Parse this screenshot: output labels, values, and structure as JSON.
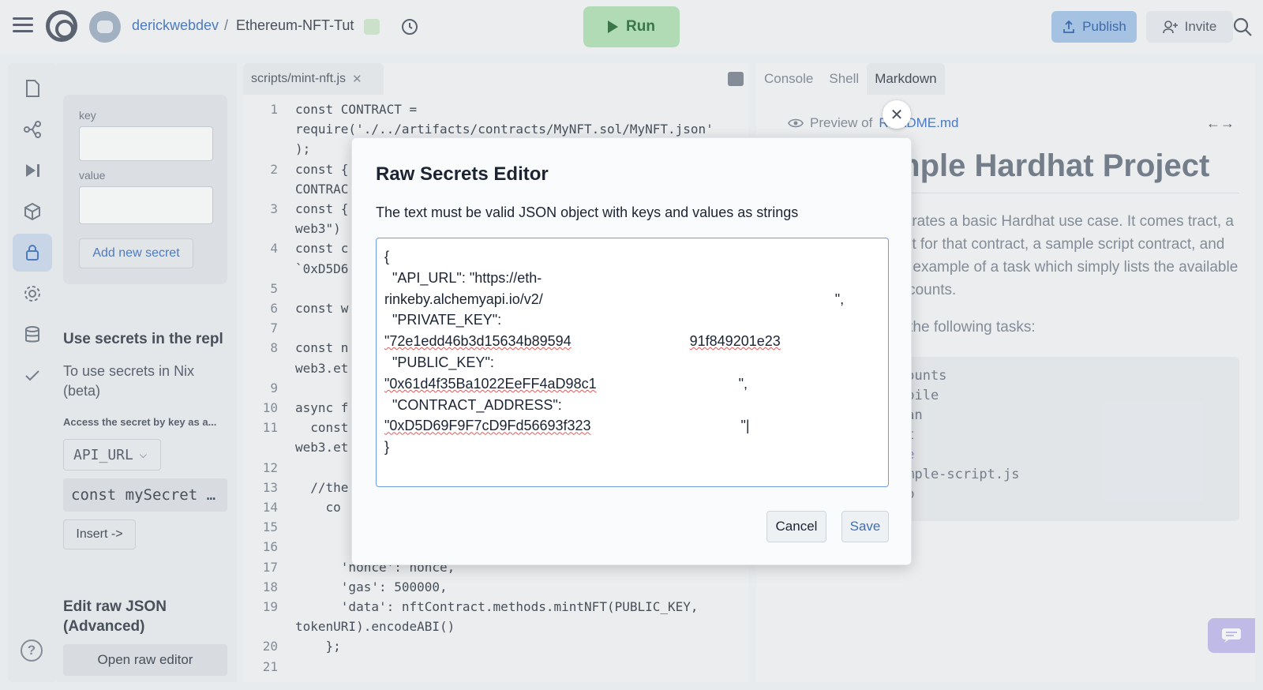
{
  "topbar": {
    "username": "derickwebdev",
    "separator": "/",
    "repl_name": "Ethereum-NFT-Tut",
    "run_label": "Run",
    "publish_label": "Publish",
    "invite_label": "Invite"
  },
  "sidebar": {
    "icons": [
      "files-icon",
      "version-control-icon",
      "debugger-icon",
      "packages-icon",
      "secrets-lock-icon",
      "settings-gear-icon",
      "database-icon",
      "checkmark-icon"
    ],
    "active": "secrets-lock-icon"
  },
  "secrets": {
    "key_label": "key",
    "value_label": "value",
    "add_button": "Add new secret",
    "use_heading": "Use secrets in the repl",
    "use_text": "To use secrets in Nix (beta)",
    "access_text": "Access the secret by key as a...",
    "selected_key": "API_URL",
    "code_snippet": "const mySecret …",
    "insert_button": "Insert ->",
    "edit_heading": "Edit raw JSON (Advanced)",
    "open_raw_button": "Open raw editor"
  },
  "editor": {
    "file_tab": "scripts/mint-nft.js",
    "lines": [
      {
        "n": "1",
        "t": "const CONTRACT ="
      },
      {
        "n": "",
        "t": "require('./../artifacts/contracts/MyNFT.sol/MyNFT.json'"
      },
      {
        "n": "",
        "t": ");"
      },
      {
        "n": "2",
        "t": "const {"
      },
      {
        "n": "",
        "t": "CONTRAC"
      },
      {
        "n": "3",
        "t": "const {"
      },
      {
        "n": "",
        "t": "web3\")"
      },
      {
        "n": "4",
        "t": "const c"
      },
      {
        "n": "",
        "t": "`0xD5D6"
      },
      {
        "n": "5",
        "t": ""
      },
      {
        "n": "6",
        "t": "const w"
      },
      {
        "n": "7",
        "t": ""
      },
      {
        "n": "8",
        "t": "const n"
      },
      {
        "n": "",
        "t": "web3.et"
      },
      {
        "n": "9",
        "t": ""
      },
      {
        "n": "10",
        "t": "async f"
      },
      {
        "n": "11",
        "t": "  const"
      },
      {
        "n": "",
        "t": "web3.et"
      },
      {
        "n": "12",
        "t": ""
      },
      {
        "n": "13",
        "t": "  //the"
      },
      {
        "n": "14",
        "t": "    co"
      },
      {
        "n": "15",
        "t": ""
      },
      {
        "n": "16",
        "t": ""
      },
      {
        "n": "17",
        "t": "      'nonce': nonce,"
      },
      {
        "n": "18",
        "t": "      'gas': 500000,"
      },
      {
        "n": "19",
        "t": "      'data': nftContract.methods.mintNFT(PUBLIC_KEY,"
      },
      {
        "n": "",
        "t": "tokenURI).encodeABI()"
      },
      {
        "n": "20",
        "t": "    };"
      },
      {
        "n": "21",
        "t": ""
      }
    ]
  },
  "right_panel": {
    "tabs": [
      "Console",
      "Shell",
      "Markdown"
    ],
    "active_tab": "Markdown",
    "preview_prefix": "Preview of",
    "preview_file": "README.md",
    "md_title": "mple Hardhat Project",
    "md_paragraph": "nstrates a basic Hardhat use case. It comes tract, a test for that contract, a sample script contract, and an example of a task which simply lists the available accounts.",
    "md_paragraph2": "of the following tasks:",
    "md_code_lines": [
      "counts",
      "mpile",
      "ean",
      "st",
      "de",
      "ample-script.js",
      "lp"
    ]
  },
  "modal": {
    "title": "Raw Secrets Editor",
    "description": "The text must be valid JSON object with keys and values as strings",
    "json_lines": [
      "{",
      "  \"API_URL\": \"https://eth-",
      "rinkeby.alchemyapi.io/v2/",
      "  \"PRIVATE_KEY\":",
      "\"72e1edd46b3d15634b89594",
      "  \"PUBLIC_KEY\":",
      "\"0x61d4f35Ba1022EeFF4aD98c1",
      "  \"CONTRACT_ADDRESS\":",
      "\"0xD5D69F9F7cD9Fd56693f323",
      "}"
    ],
    "private_key_tail": "91f849201e23",
    "cancel_label": "Cancel",
    "save_label": "Save"
  }
}
